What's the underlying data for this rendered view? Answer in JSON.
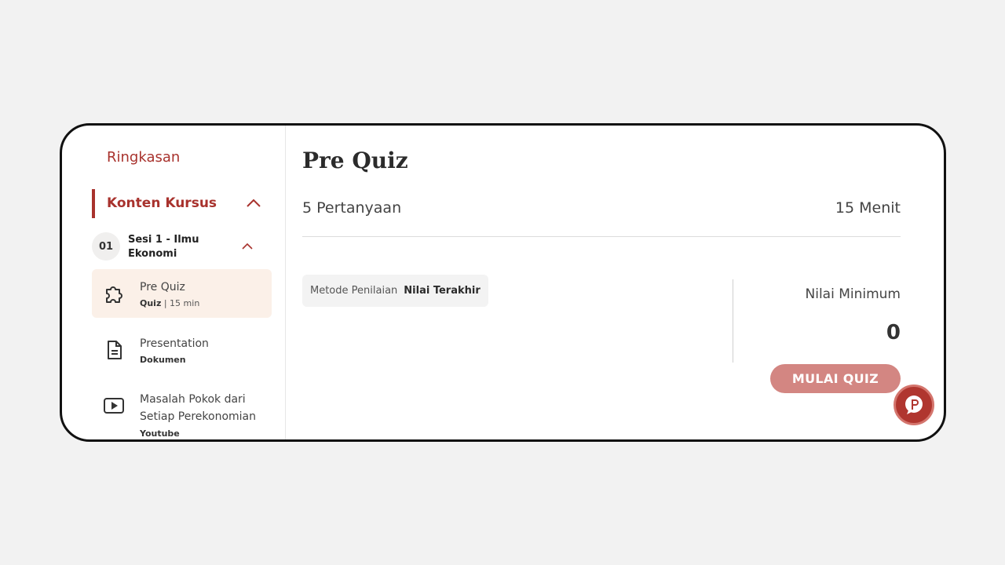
{
  "sidebar": {
    "ringkasan": "Ringkasan",
    "konten_kursus": "Konten Kursus",
    "session": {
      "number": "01",
      "title": "Sesi 1 - Ilmu Ekonomi"
    },
    "items": [
      {
        "title": "Pre Quiz",
        "type": "Quiz",
        "duration": "| 15 min",
        "icon": "puzzle-icon",
        "active": true
      },
      {
        "title": "Presentation",
        "type": "Dokumen",
        "icon": "document-icon",
        "active": false
      },
      {
        "title": "Masalah Pokok dari Setiap Perekonomian",
        "type": "Youtube",
        "icon": "video-play-icon",
        "active": false
      }
    ]
  },
  "main": {
    "title": "Pre Quiz",
    "question_count": "5 Pertanyaan",
    "duration": "15 Menit",
    "metode_label": "Metode Penilaian",
    "metode_value": "Nilai Terakhir",
    "nilai_min_label": "Nilai Minimum",
    "nilai_min_value": "0",
    "start_button": "MULAI QUIZ"
  },
  "colors": {
    "accent": "#a8322d",
    "button": "#d38682",
    "active_item_bg": "#fbf0e8"
  },
  "fab": {
    "icon": "p-chat-icon"
  }
}
